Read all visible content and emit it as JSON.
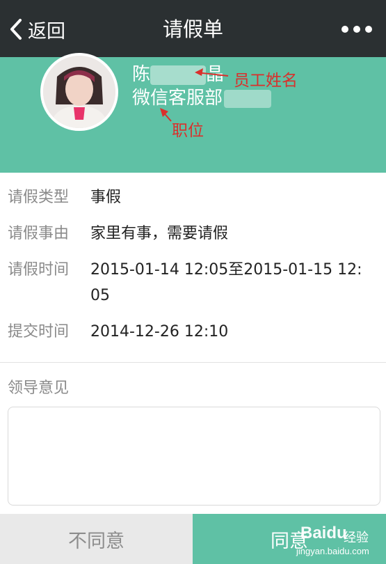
{
  "navbar": {
    "back_label": "返回",
    "title": "请假单"
  },
  "profile": {
    "name_prefix": "陈",
    "name_suffix": "晶",
    "department": "微信客服部",
    "annotation_name": "员工姓名",
    "annotation_position": "职位"
  },
  "details": {
    "rows": [
      {
        "label": "请假类型",
        "value": "事假"
      },
      {
        "label": "请假事由",
        "value": "家里有事，需要请假"
      },
      {
        "label": "请假时间",
        "value": "2015-01-14 12:05至2015-01-15 12:05"
      },
      {
        "label": "提交时间",
        "value": "2014-12-26 12:10"
      }
    ]
  },
  "opinion": {
    "label": "领导意见",
    "value": ""
  },
  "footer": {
    "reject_label": "不同意",
    "approve_label": "同意"
  },
  "watermark": {
    "brand": "Baidu",
    "suffix": "经验",
    "url": "jingyan.baidu.com"
  },
  "colors": {
    "navbar": "#2b3032",
    "accent": "#5fc1a5",
    "annotation": "#d9302c"
  }
}
